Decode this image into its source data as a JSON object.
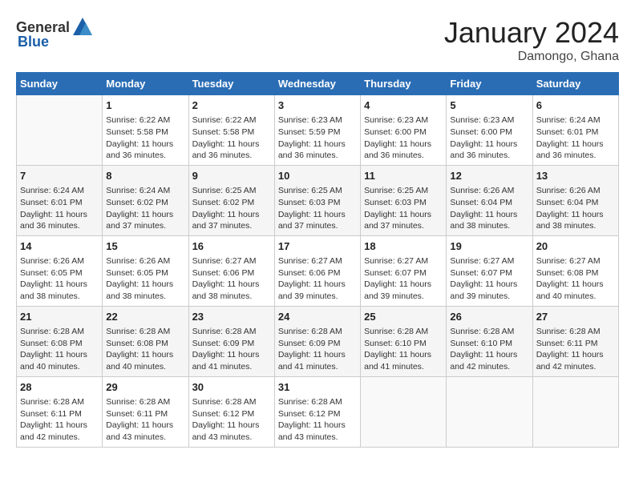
{
  "header": {
    "logo_general": "General",
    "logo_blue": "Blue",
    "month": "January 2024",
    "location": "Damongo, Ghana"
  },
  "days_of_week": [
    "Sunday",
    "Monday",
    "Tuesday",
    "Wednesday",
    "Thursday",
    "Friday",
    "Saturday"
  ],
  "weeks": [
    [
      {
        "day": "",
        "info": ""
      },
      {
        "day": "1",
        "info": "Sunrise: 6:22 AM\nSunset: 5:58 PM\nDaylight: 11 hours\nand 36 minutes."
      },
      {
        "day": "2",
        "info": "Sunrise: 6:22 AM\nSunset: 5:58 PM\nDaylight: 11 hours\nand 36 minutes."
      },
      {
        "day": "3",
        "info": "Sunrise: 6:23 AM\nSunset: 5:59 PM\nDaylight: 11 hours\nand 36 minutes."
      },
      {
        "day": "4",
        "info": "Sunrise: 6:23 AM\nSunset: 6:00 PM\nDaylight: 11 hours\nand 36 minutes."
      },
      {
        "day": "5",
        "info": "Sunrise: 6:23 AM\nSunset: 6:00 PM\nDaylight: 11 hours\nand 36 minutes."
      },
      {
        "day": "6",
        "info": "Sunrise: 6:24 AM\nSunset: 6:01 PM\nDaylight: 11 hours\nand 36 minutes."
      }
    ],
    [
      {
        "day": "7",
        "info": "Sunrise: 6:24 AM\nSunset: 6:01 PM\nDaylight: 11 hours\nand 36 minutes."
      },
      {
        "day": "8",
        "info": "Sunrise: 6:24 AM\nSunset: 6:02 PM\nDaylight: 11 hours\nand 37 minutes."
      },
      {
        "day": "9",
        "info": "Sunrise: 6:25 AM\nSunset: 6:02 PM\nDaylight: 11 hours\nand 37 minutes."
      },
      {
        "day": "10",
        "info": "Sunrise: 6:25 AM\nSunset: 6:03 PM\nDaylight: 11 hours\nand 37 minutes."
      },
      {
        "day": "11",
        "info": "Sunrise: 6:25 AM\nSunset: 6:03 PM\nDaylight: 11 hours\nand 37 minutes."
      },
      {
        "day": "12",
        "info": "Sunrise: 6:26 AM\nSunset: 6:04 PM\nDaylight: 11 hours\nand 38 minutes."
      },
      {
        "day": "13",
        "info": "Sunrise: 6:26 AM\nSunset: 6:04 PM\nDaylight: 11 hours\nand 38 minutes."
      }
    ],
    [
      {
        "day": "14",
        "info": "Sunrise: 6:26 AM\nSunset: 6:05 PM\nDaylight: 11 hours\nand 38 minutes."
      },
      {
        "day": "15",
        "info": "Sunrise: 6:26 AM\nSunset: 6:05 PM\nDaylight: 11 hours\nand 38 minutes."
      },
      {
        "day": "16",
        "info": "Sunrise: 6:27 AM\nSunset: 6:06 PM\nDaylight: 11 hours\nand 38 minutes."
      },
      {
        "day": "17",
        "info": "Sunrise: 6:27 AM\nSunset: 6:06 PM\nDaylight: 11 hours\nand 39 minutes."
      },
      {
        "day": "18",
        "info": "Sunrise: 6:27 AM\nSunset: 6:07 PM\nDaylight: 11 hours\nand 39 minutes."
      },
      {
        "day": "19",
        "info": "Sunrise: 6:27 AM\nSunset: 6:07 PM\nDaylight: 11 hours\nand 39 minutes."
      },
      {
        "day": "20",
        "info": "Sunrise: 6:27 AM\nSunset: 6:08 PM\nDaylight: 11 hours\nand 40 minutes."
      }
    ],
    [
      {
        "day": "21",
        "info": "Sunrise: 6:28 AM\nSunset: 6:08 PM\nDaylight: 11 hours\nand 40 minutes."
      },
      {
        "day": "22",
        "info": "Sunrise: 6:28 AM\nSunset: 6:08 PM\nDaylight: 11 hours\nand 40 minutes."
      },
      {
        "day": "23",
        "info": "Sunrise: 6:28 AM\nSunset: 6:09 PM\nDaylight: 11 hours\nand 41 minutes."
      },
      {
        "day": "24",
        "info": "Sunrise: 6:28 AM\nSunset: 6:09 PM\nDaylight: 11 hours\nand 41 minutes."
      },
      {
        "day": "25",
        "info": "Sunrise: 6:28 AM\nSunset: 6:10 PM\nDaylight: 11 hours\nand 41 minutes."
      },
      {
        "day": "26",
        "info": "Sunrise: 6:28 AM\nSunset: 6:10 PM\nDaylight: 11 hours\nand 42 minutes."
      },
      {
        "day": "27",
        "info": "Sunrise: 6:28 AM\nSunset: 6:11 PM\nDaylight: 11 hours\nand 42 minutes."
      }
    ],
    [
      {
        "day": "28",
        "info": "Sunrise: 6:28 AM\nSunset: 6:11 PM\nDaylight: 11 hours\nand 42 minutes."
      },
      {
        "day": "29",
        "info": "Sunrise: 6:28 AM\nSunset: 6:11 PM\nDaylight: 11 hours\nand 43 minutes."
      },
      {
        "day": "30",
        "info": "Sunrise: 6:28 AM\nSunset: 6:12 PM\nDaylight: 11 hours\nand 43 minutes."
      },
      {
        "day": "31",
        "info": "Sunrise: 6:28 AM\nSunset: 6:12 PM\nDaylight: 11 hours\nand 43 minutes."
      },
      {
        "day": "",
        "info": ""
      },
      {
        "day": "",
        "info": ""
      },
      {
        "day": "",
        "info": ""
      }
    ]
  ]
}
